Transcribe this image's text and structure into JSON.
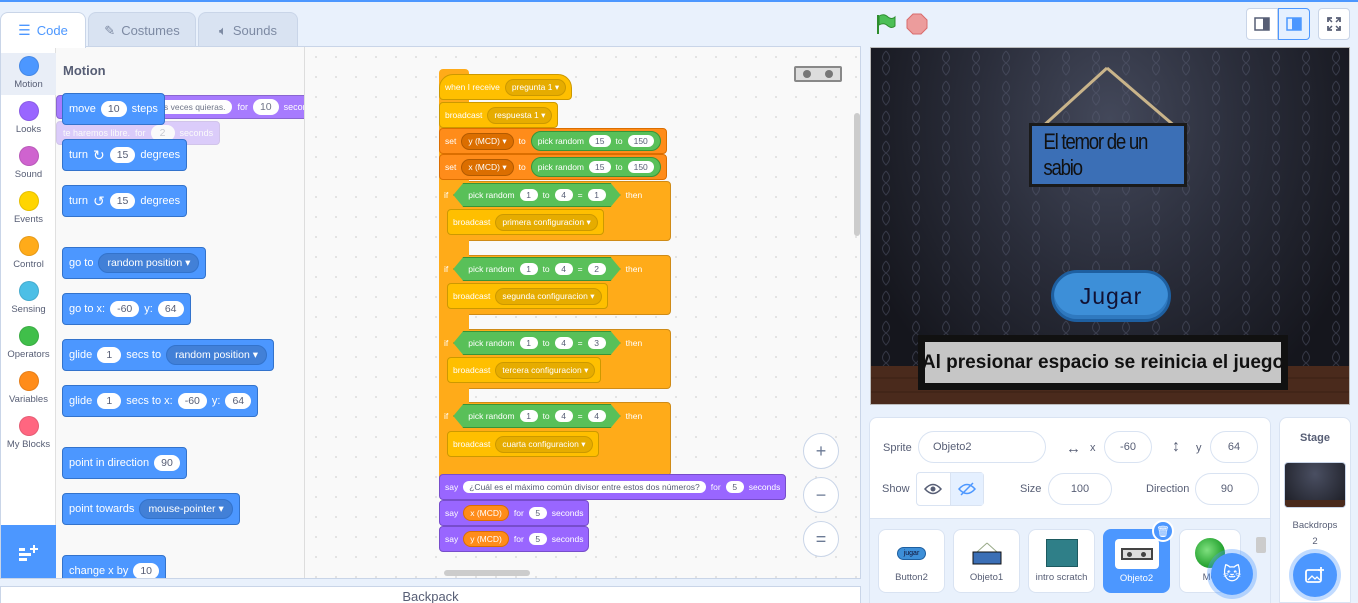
{
  "tabs": {
    "code": "Code",
    "costumes": "Costumes",
    "sounds": "Sounds"
  },
  "categories": [
    {
      "label": "Motion",
      "color": "#4c97ff"
    },
    {
      "label": "Looks",
      "color": "#9966ff"
    },
    {
      "label": "Sound",
      "color": "#cf63cf"
    },
    {
      "label": "Events",
      "color": "#ffd500"
    },
    {
      "label": "Control",
      "color": "#ffab19"
    },
    {
      "label": "Sensing",
      "color": "#4cbfe6"
    },
    {
      "label": "Operators",
      "color": "#40bf4a"
    },
    {
      "label": "Variables",
      "color": "#ff8c1a"
    },
    {
      "label": "My Blocks",
      "color": "#ff6680"
    }
  ],
  "palette": {
    "title": "Motion",
    "move": {
      "a": "move",
      "v": "10",
      "b": "steps"
    },
    "turn_cw": {
      "a": "turn",
      "v": "15",
      "b": "degrees"
    },
    "turn_ccw": {
      "a": "turn",
      "v": "15",
      "b": "degrees"
    },
    "goto": {
      "a": "go to",
      "dd": "random position"
    },
    "gotoxy": {
      "a": "go to x:",
      "x": "-60",
      "b": "y:",
      "y": "64"
    },
    "glide": {
      "a": "glide",
      "v": "1",
      "b": "secs to",
      "dd": "random position"
    },
    "glidexy": {
      "a": "glide",
      "v": "1",
      "b": "secs to x:",
      "x": "-60",
      "c": "y:",
      "y": "64"
    },
    "point_dir": {
      "a": "point in direction",
      "v": "90"
    },
    "point_towards": {
      "a": "point towards",
      "dd": "mouse-pointer"
    },
    "change_x": {
      "a": "change x by",
      "v": "10"
    },
    "ghost1": {
      "a": "usar papel y lápiz cuantas veces quieras.",
      "b": "for",
      "v": "10",
      "c": "seconds"
    },
    "ghost2": {
      "a": "te haremos libre.",
      "b": "for",
      "v": "2",
      "c": "seconds"
    }
  },
  "script": {
    "hat": {
      "a": "when I receive",
      "dd": "pregunta 1"
    },
    "broadcast1": {
      "a": "broadcast",
      "dd": "respuesta 1"
    },
    "set_y": {
      "a": "set",
      "var": "y (MCD)",
      "b": "to",
      "op": "pick random",
      "v1": "15",
      "c": "to",
      "v2": "150"
    },
    "set_x": {
      "a": "set",
      "var": "x (MCD)",
      "b": "to",
      "op": "pick random",
      "v1": "15",
      "c": "to",
      "v2": "150"
    },
    "ifs": [
      {
        "if": "if",
        "op": "pick random",
        "v1": "1",
        "to": "to",
        "v2": "4",
        "eq": "=",
        "n": "1",
        "then": "then",
        "bc": "broadcast",
        "msg": "primera configuracion"
      },
      {
        "if": "if",
        "op": "pick random",
        "v1": "1",
        "to": "to",
        "v2": "4",
        "eq": "=",
        "n": "2",
        "then": "then",
        "bc": "broadcast",
        "msg": "segunda configuracion"
      },
      {
        "if": "if",
        "op": "pick random",
        "v1": "1",
        "to": "to",
        "v2": "4",
        "eq": "=",
        "n": "3",
        "then": "then",
        "bc": "broadcast",
        "msg": "tercera configuracion"
      },
      {
        "if": "if",
        "op": "pick random",
        "v1": "1",
        "to": "to",
        "v2": "4",
        "eq": "=",
        "n": "4",
        "then": "then",
        "bc": "broadcast",
        "msg": "cuarta configuracion"
      }
    ],
    "say1": {
      "a": "say",
      "msg": "¿Cuál es el máximo común divisor entre estos dos números?",
      "b": "for",
      "v": "5",
      "c": "seconds"
    },
    "say2": {
      "a": "say",
      "var": "x (MCD)",
      "b": "for",
      "v": "5",
      "c": "seconds"
    },
    "say3": {
      "a": "say",
      "var": "y (MCD)",
      "b": "for",
      "v": "5",
      "c": "seconds"
    }
  },
  "zoom": {
    "in": "+",
    "out": "−",
    "reset": "="
  },
  "backpack": "Backpack",
  "stage": {
    "sign_text": "El temor de un sabio",
    "play_button": "Jugar",
    "caption": "Al presionar espacio se reinicia el juego"
  },
  "sprite_info": {
    "sprite_label": "Sprite",
    "sprite_name": "Objeto2",
    "x_label": "x",
    "x": "-60",
    "y_label": "y",
    "y": "64",
    "show_label": "Show",
    "size_label": "Size",
    "size": "100",
    "direction_label": "Direction",
    "direction": "90"
  },
  "sprites": [
    {
      "name": "Button2",
      "thumb": "jugar"
    },
    {
      "name": "Objeto1",
      "thumb": ""
    },
    {
      "name": "intro scratch",
      "thumb": ""
    },
    {
      "name": "Objeto2",
      "thumb": ""
    },
    {
      "name": "MC",
      "thumb": ""
    }
  ],
  "stage_panel": {
    "title": "Stage",
    "backdrops_label": "Backdrops",
    "backdrops_count": "2"
  },
  "colors": {
    "accent": "#4c97ff",
    "motion": "#4c97ff",
    "control": "#ffab19",
    "events": "#ffbf00",
    "operators": "#59c059",
    "looks": "#9966ff",
    "variables": "#ff8c1a"
  }
}
